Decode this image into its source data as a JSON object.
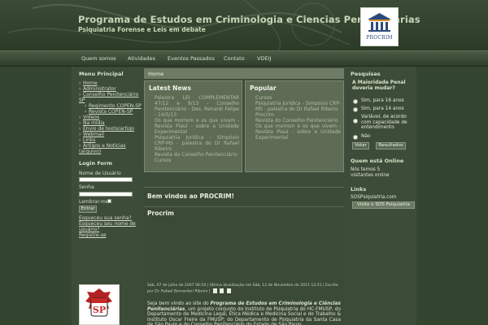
{
  "header": {
    "title": "Programa de Estudos em Criminologia e Ciencias Penitenciarias",
    "subtitle": "Psiquiatria Forense e Leis em debate",
    "logo_text": "PROCRIM"
  },
  "nav": [
    "Quem somos",
    "Atividades",
    "Eventos Passados",
    "Contato",
    "VDEIJ"
  ],
  "left": {
    "menu_title": "Menu Principal",
    "menu_items": [
      {
        "label": "Home"
      },
      {
        "label": "Administrator"
      },
      {
        "label": "Conselho Penitenciário SP"
      },
      {
        "label": "Regimento COPEN-SP"
      },
      {
        "label": "Revista COPEN-SP"
      },
      {
        "label": "Vídeos"
      },
      {
        "label": "Na mídia"
      },
      {
        "label": "Envio de texto/artigo"
      },
      {
        "label": "Webmail"
      },
      {
        "label": "Links"
      },
      {
        "label": "Artigos e Notícias (arquivo)"
      }
    ],
    "login_title": "Login Form",
    "username_label": "Nome de Usuário",
    "password_label": "Senha",
    "remember_label": "Lembrar-me",
    "enter_button": "Entrar",
    "forgot_password": "Esqueceu sua senha?",
    "forgot_username": "Esqueceu seu nome de usuário?",
    "register": "Registre-se"
  },
  "center": {
    "breadcrumb": "Home",
    "latest_news_title": "Latest News",
    "latest_news": [
      "Palestra LEI COMPLEMENTAR 47/12 e 9/13 - Conselho Penitenciário - Des. Renardi Felipe - 14/5/13",
      "Os que morrem e os que vivem - Revista Piauí - sobre a Unidade Experimental",
      "Psiquiatria Jurídica - Simpósio CRP-MS - palestra do Dr Rafael Ribeiro",
      "Revista do Conselho Penitenciário",
      "Cursos"
    ],
    "popular_title": "Popular",
    "popular": [
      "Cursos",
      "Psiquiatria Jurídica - Simpósio CRP-MS - palestra do Dr Rafael Ribeiro",
      "Procrim",
      "Revista do Conselho Penitenciário",
      "Os que morrem e os que vivem - Revista Piauí - sobre a Unidade Experimental"
    ],
    "welcome_title": "Bem vindos ao PROCRIM!",
    "article_title": "Procrim",
    "article_meta": "Sáb, 07 de julho de 2007 06:54 | Última atualização em Sáb, 12 de Novembro de 2011 12:31 | Escrito por Dr. Rafael Bernardon Ribeiro |",
    "article_body_intro": "Seja bem vindo ao site do ",
    "article_body_italic": "Programa de Estudos em Criminologia e Ciências Penitenciárias",
    "article_body_rest": ", um projeto conjunto do Instituto de Psiquiatria do HC-FMUSP, do Departamento de Medicina Legal, Ética Médica e Medicina Social e do Trabalho & Instituto Oscar Freire da FMUSP; do Departamento de Psiquiatria da Santa Casa de São Paulo e do Conselho Penitenciário do Estado de São Paulo."
  },
  "right": {
    "poll_title": "Pesquisas",
    "poll_question": "A Maioridade Penal deveria mudar?",
    "poll_options": [
      "Sim, para 16 anos",
      "Sim, para 14 anos",
      "Variável, de acordo com capacidade de entendimento",
      "Não"
    ],
    "vote_button": "Votar",
    "results_button": "Resultados",
    "online_title": "Quem está Online",
    "online_text": "Nós temos 5 visitantes online",
    "links_title": "Links",
    "links_item": "SOSPsiquiatria.com",
    "links_button": "Visite o SOS Psiquiatria"
  }
}
